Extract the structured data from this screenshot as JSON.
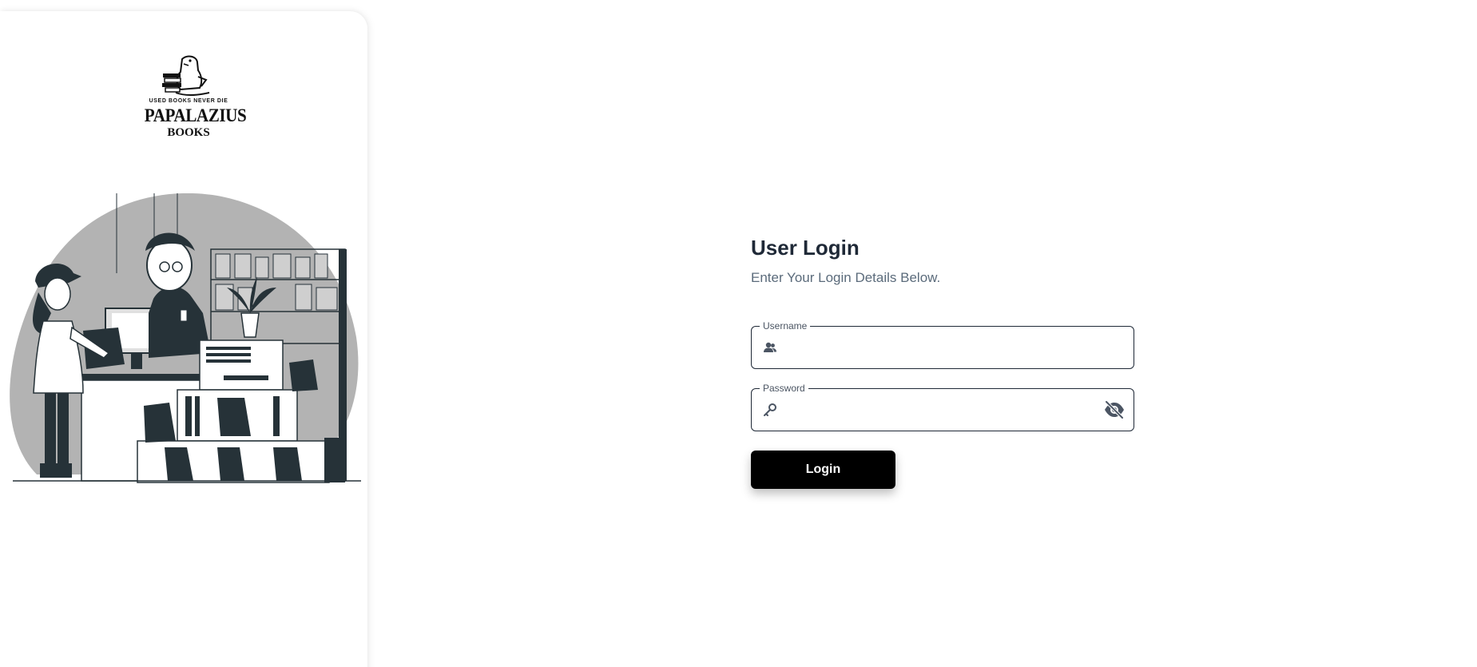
{
  "brand": {
    "tagline": "USED BOOKS NEVER DIE",
    "name": "PAPALAZIUS",
    "sub": "BOOKS"
  },
  "login": {
    "title": "User Login",
    "subtitle": "Enter Your Login Details Below.",
    "username_label": "Username",
    "username_value": "",
    "password_label": "Password",
    "password_value": "",
    "button_label": "Login"
  },
  "icons": {
    "username": "user-group-icon",
    "password": "key-icon",
    "password_toggle": "eye-slash-icon",
    "logo": "dinosaur-books-logo",
    "illustration": "bookstore-checkout-illustration"
  },
  "colors": {
    "title": "#1f2937",
    "subtitle": "#5b6b7b",
    "button_bg": "#000000",
    "button_text": "#ffffff",
    "field_border": "#1f2937",
    "illustration_blob": "#b3b3b3",
    "illustration_dark": "#263238"
  }
}
